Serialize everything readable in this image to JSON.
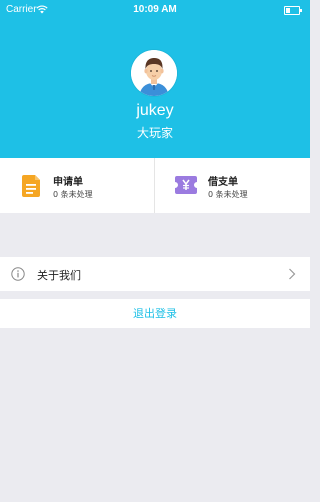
{
  "status_bar": {
    "carrier": "Carrier",
    "time": "10:09 AM"
  },
  "profile": {
    "username": "jukey",
    "role": "大玩家",
    "header_color": "#1ec0e6"
  },
  "quick_actions": [
    {
      "title": "申请单",
      "subtitle": "0 条未处理",
      "icon": "document-icon",
      "icon_color": "#f5a623"
    },
    {
      "title": "借支单",
      "subtitle": "0 条未处理",
      "icon": "ticket-yen-icon",
      "icon_color": "#9b7be0"
    }
  ],
  "menu": {
    "about_label": "关于我们"
  },
  "logout_label": "退出登录"
}
